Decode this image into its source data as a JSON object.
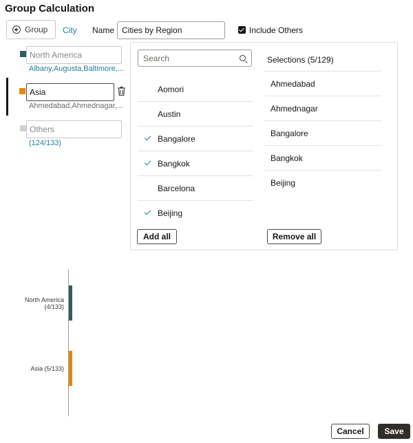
{
  "dialog": {
    "title": "Group Calculation"
  },
  "toolbar": {
    "group_button": "Group",
    "city_link": "City",
    "name_label": "Name",
    "name_value": "Cities by Region",
    "include_others_label": "Include Others",
    "include_others_checked": true
  },
  "groups": [
    {
      "name": "North America",
      "members": "Albany,Augusta,Baltimore,...",
      "color": "#2c5f63",
      "is_placeholder": true
    },
    {
      "name": "Asia",
      "members": "Ahmedabad,Ahmednagar,...",
      "color": "#e2861a",
      "is_placeholder": false
    },
    {
      "name": "Others",
      "members": "(124/133)",
      "color": "#d3d1cf",
      "is_placeholder": true
    }
  ],
  "panel": {
    "search_placeholder": "Search",
    "selections_header": "Selections (5/129)",
    "cities": [
      {
        "name": "Aomori",
        "checked": false
      },
      {
        "name": "Austin",
        "checked": false
      },
      {
        "name": "Bangalore",
        "checked": true
      },
      {
        "name": "Bangkok",
        "checked": true
      },
      {
        "name": "Barcelona",
        "checked": false
      },
      {
        "name": "Beijing",
        "checked": true
      }
    ],
    "selections": [
      "Ahmedabad",
      "Ahmednagar",
      "Bangalore",
      "Bangkok",
      "Beijing"
    ],
    "add_all": "Add all",
    "remove_all": "Remove all"
  },
  "preview": {
    "bars": [
      {
        "label": "North America\n(4/133)",
        "value": 4,
        "color": "#2c5f63"
      },
      {
        "label": "Asia (5/133)",
        "value": 5,
        "color": "#e2861a"
      }
    ]
  },
  "footer": {
    "cancel": "Cancel",
    "save": "Save"
  },
  "colors": {
    "accent": "#227e9e",
    "primary_button": "#312d2a"
  }
}
